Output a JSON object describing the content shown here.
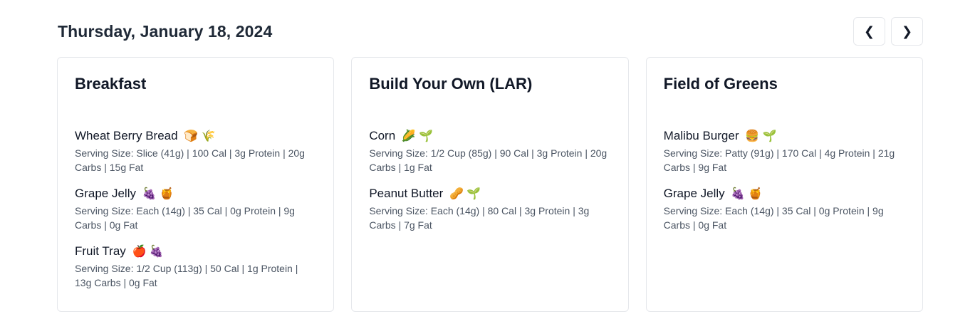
{
  "header": {
    "date": "Thursday, January 18, 2024",
    "prev_label": "❮",
    "next_label": "❯"
  },
  "cards": [
    {
      "title": "Breakfast",
      "items": [
        {
          "name": "Wheat Berry Bread",
          "emoji": "🍞 🌾",
          "info": "Serving Size: Slice (41g) | 100 Cal | 3g Protein | 20g Carbs | 15g Fat"
        },
        {
          "name": "Grape Jelly",
          "emoji": "🍇 🍯",
          "info": "Serving Size: Each (14g) | 35 Cal | 0g Protein | 9g Carbs | 0g Fat"
        },
        {
          "name": "Fruit Tray",
          "emoji": "🍎 🍇",
          "info": "Serving Size: 1/2 Cup (113g) | 50 Cal | 1g Protein | 13g Carbs | 0g Fat"
        }
      ]
    },
    {
      "title": "Build Your Own (LAR)",
      "items": [
        {
          "name": "Corn",
          "emoji": "🌽 🌱",
          "info": "Serving Size: 1/2 Cup (85g) | 90 Cal | 3g Protein | 20g Carbs | 1g Fat"
        },
        {
          "name": "Peanut Butter",
          "emoji": "🥜 🌱",
          "info": "Serving Size: Each (14g) | 80 Cal | 3g Protein | 3g Carbs | 7g Fat"
        }
      ]
    },
    {
      "title": "Field of Greens",
      "items": [
        {
          "name": "Malibu Burger",
          "emoji": "🍔 🌱",
          "info": "Serving Size: Patty (91g) | 170 Cal | 4g Protein | 21g Carbs | 9g Fat"
        },
        {
          "name": "Grape Jelly",
          "emoji": "🍇 🍯",
          "info": "Serving Size: Each (14g) | 35 Cal | 0g Protein | 9g Carbs | 0g Fat"
        }
      ]
    }
  ]
}
